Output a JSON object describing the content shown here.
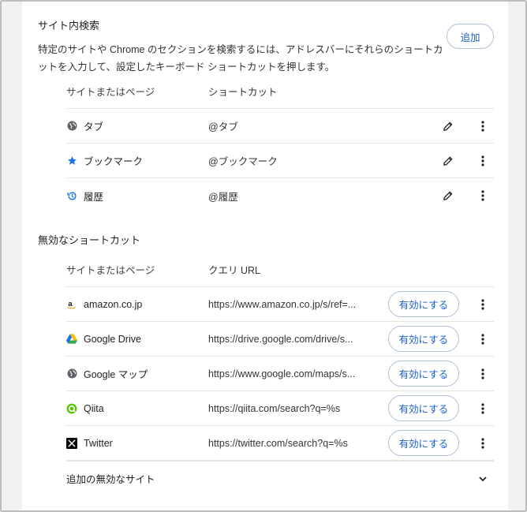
{
  "search": {
    "title": "サイト内検索",
    "description": "特定のサイトや Chrome のセクションを検索するには、アドレスバーにそれらのショートカットを入力して、設定したキーボード ショートカットを押します。",
    "add_label": "追加",
    "header_site": "サイトまたはページ",
    "header_shortcut": "ショートカット",
    "rows": [
      {
        "site": "タブ",
        "shortcut": "@タブ",
        "icon": "globe-icon"
      },
      {
        "site": "ブックマーク",
        "shortcut": "@ブックマーク",
        "icon": "star-icon"
      },
      {
        "site": "履歴",
        "shortcut": "@履歴",
        "icon": "history-icon"
      }
    ]
  },
  "inactive": {
    "title": "無効なショートカット",
    "header_site": "サイトまたはページ",
    "header_query": "クエリ URL",
    "enable_label": "有効にする",
    "rows": [
      {
        "site": "amazon.co.jp",
        "url": "https://www.amazon.co.jp/s/ref=...",
        "icon": "amazon-icon"
      },
      {
        "site": "Google Drive",
        "url": "https://drive.google.com/drive/s...",
        "icon": "google-drive-icon"
      },
      {
        "site": "Google マップ",
        "url": "https://www.google.com/maps/s...",
        "icon": "globe-icon"
      },
      {
        "site": "Qiita",
        "url": "https://qiita.com/search?q=%s",
        "icon": "qiita-icon"
      },
      {
        "site": "Twitter",
        "url": "https://twitter.com/search?q=%s",
        "icon": "x-icon"
      }
    ],
    "more_label": "追加の無効なサイト"
  },
  "colors": {
    "accent": "#1a5fc8",
    "star": "#1a73e8"
  }
}
